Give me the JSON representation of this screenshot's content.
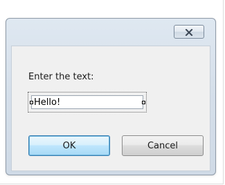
{
  "dialog": {
    "close_icon": "close-x-icon",
    "prompt_label": "Enter the text:",
    "input": {
      "value": "Hello!",
      "placeholder": ""
    },
    "ok_label": "OK",
    "cancel_label": "Cancel"
  },
  "colors": {
    "frame_border": "#8e9aa8",
    "frame_gradient_top": "#dfe8f1",
    "client_background": "#f0f0f0",
    "default_button_border": "#3c7fb1"
  }
}
